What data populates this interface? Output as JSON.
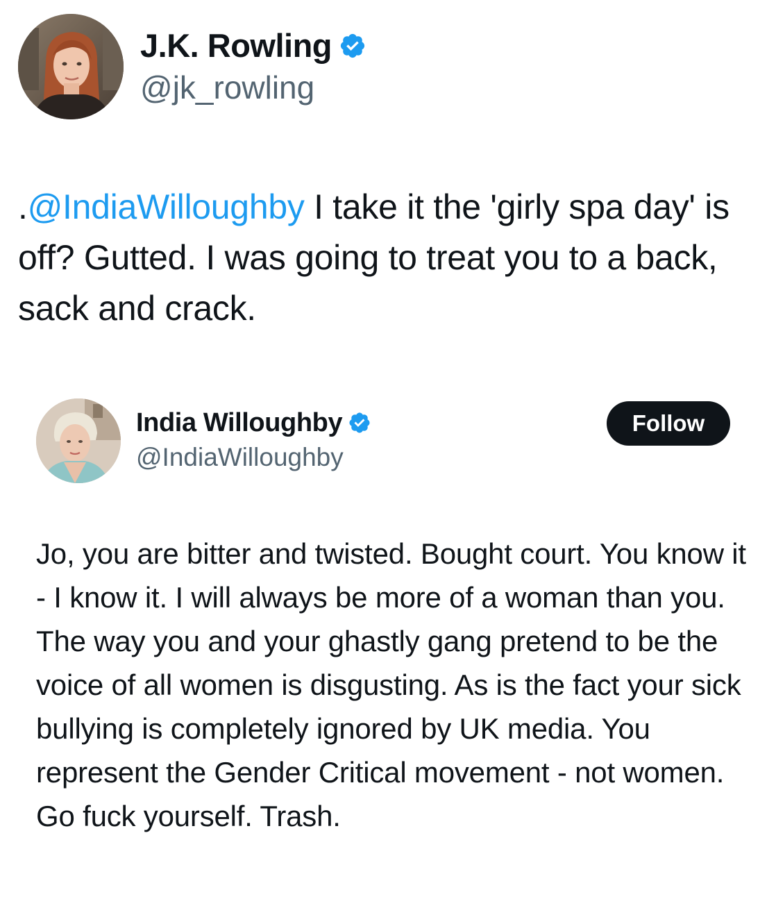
{
  "tweet": {
    "author": {
      "display_name": "J.K. Rowling",
      "handle": "@jk_rowling",
      "verified": true,
      "avatar": "profile-photo-woman-red-hair"
    },
    "text_prefix": ".",
    "mention": "@IndiaWilloughby",
    "text_body": " I take it the 'girly spa day' is off? Gutted. I was going to treat you to a back, sack and crack."
  },
  "quoted_tweet": {
    "author": {
      "display_name": "India Willoughby",
      "handle": "@IndiaWilloughby",
      "verified": true,
      "avatar": "profile-photo-woman-blonde-hair"
    },
    "follow_label": "Follow",
    "text": "Jo, you are bitter and twisted. Bought court. You know it - I know it. I will always be more of a woman than you. The way you and your ghastly gang pretend to be the voice of all women is disgusting. As is the fact your sick bullying is completely ignored by UK media. You represent the Gender Critical movement - not women.  Go fuck yourself. Trash."
  },
  "colors": {
    "text": "#0f1419",
    "secondary": "#536471",
    "link": "#1d9bf0",
    "verified_badge": "#1d9bf0",
    "follow_button_bg": "#0f1419",
    "background": "#ffffff"
  },
  "icons": {
    "verified": "verified-badge-icon"
  }
}
